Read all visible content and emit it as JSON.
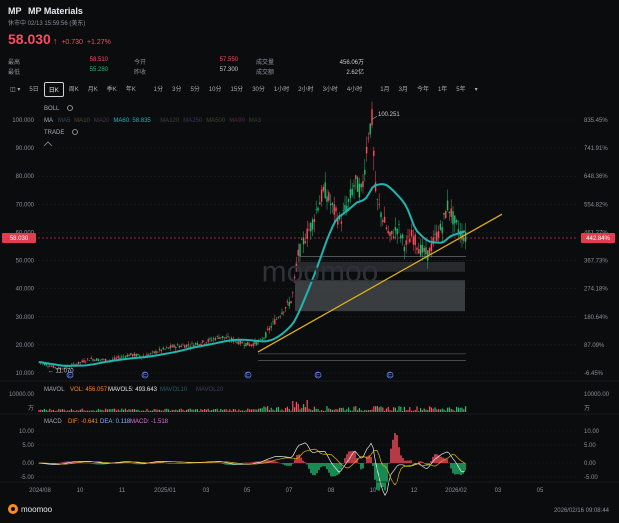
{
  "header": {
    "ticker": "MP",
    "name": "MP Materials",
    "status": "休市中 02/13 15:59:56 (美东)",
    "price": "58.030",
    "change": "+0.730",
    "change_pct": "+1.27%"
  },
  "stats": {
    "high_label": "最高",
    "high": "58.510",
    "low_label": "最低",
    "low": "55.280",
    "open_label": "今开",
    "open": "57.550",
    "prev_close_label": "昨收",
    "prev_close": "57.300",
    "volume_label": "成交量",
    "volume": "456.06万",
    "turnover_label": "成交额",
    "turnover": "2.62亿"
  },
  "toolbar": {
    "items": [
      "5日",
      "日K",
      "周K",
      "月K",
      "季K",
      "年K",
      "1分",
      "3分",
      "5分",
      "10分",
      "15分",
      "30分",
      "1小时",
      "2小时",
      "3小时",
      "4小时",
      "1月",
      "3月",
      "今年",
      "1年",
      "5年"
    ],
    "active": "日K"
  },
  "main_chart": {
    "boll_label": "BOLL",
    "ma_label": "MA",
    "ma_items": [
      {
        "name": "MA5",
        "color": "#3a4a5a"
      },
      {
        "name": "MA10",
        "color": "#4a4a30"
      },
      {
        "name": "MA20",
        "color": "#4a3050"
      },
      {
        "name": "MA60: 58.835",
        "color": "#1fb5b0"
      },
      {
        "name": "MA120",
        "color": "#404040"
      },
      {
        "name": "MA250",
        "color": "#303a50"
      },
      {
        "name": "MA500",
        "color": "#4a4030"
      },
      {
        "name": "MA90",
        "color": "#4a3040"
      },
      {
        "name": "MA3",
        "color": "#3a4030"
      }
    ],
    "trade_label": "TRADE",
    "y_ticks": [
      "100.000",
      "90.000",
      "80.000",
      "70.000",
      "60.000",
      "50.000",
      "40.000",
      "30.000",
      "20.000",
      "10.000"
    ],
    "pct_ticks": [
      "835.45%",
      "741.91%",
      "648.36%",
      "554.82%",
      "461.27%",
      "367.73%",
      "274.18%",
      "180.64%",
      "87.09%",
      "-6.45%"
    ],
    "price_tag": "58.030",
    "pct_tag": "442.84%",
    "high_marker": "100.251",
    "low_marker": "11.070",
    "watermark": "moomoo"
  },
  "vol_panel": {
    "label": "MAVOL",
    "vol": "VOL: 456.057",
    "mavol5": "MAVOL5: 493.643",
    "mavol10": "MAVOL10",
    "mavol20": "MAVOL20",
    "tick_top": "10000.00",
    "unit": "万"
  },
  "macd_panel": {
    "label": "MACD",
    "dif": "DIF: -0.641",
    "dea": "DEA: 0.118",
    "macd": "MACD: -1.518",
    "ticks": [
      "10.00",
      "5.00",
      "0.00",
      "-5.00"
    ]
  },
  "x_ticks": [
    "2024/08",
    "10",
    "11",
    "2025/01",
    "03",
    "05",
    "07",
    "08",
    "10",
    "12",
    "2026/02",
    "03",
    "05"
  ],
  "colors": {
    "up": "#ff4d5f",
    "down": "#1fbf6e",
    "ma60": "#1fb5b0",
    "trend": "#e6b417",
    "accent": "#ff8a1f"
  },
  "footer": {
    "brand": "moomoo",
    "timestamp": "2026/02/16 09:08:44"
  }
}
